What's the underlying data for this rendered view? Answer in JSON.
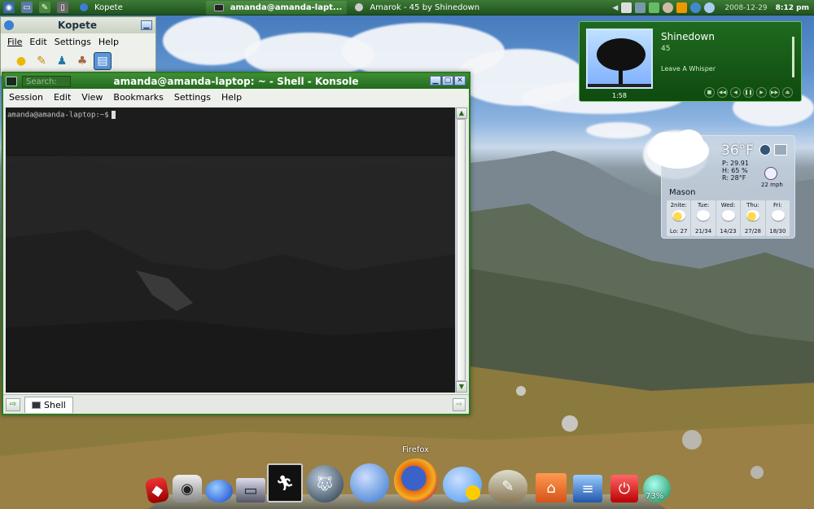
{
  "top_panel": {
    "tasks": [
      {
        "label": "Kopete",
        "active": false
      },
      {
        "label": "amanda@amanda-lapt...",
        "active": true
      },
      {
        "label": "Amarok - 45 by Shinedown",
        "active": false
      }
    ],
    "date": "2008-12-29",
    "time": "8:12 pm"
  },
  "kopete": {
    "title": "Kopete",
    "menu": [
      "File",
      "Edit",
      "Settings",
      "Help"
    ]
  },
  "konsole": {
    "title": "amanda@amanda-laptop: ~ - Shell - Konsole",
    "search_placeholder": "Search:",
    "menu": [
      "Session",
      "Edit",
      "View",
      "Bookmarks",
      "Settings",
      "Help"
    ],
    "prompt": "amanda@amanda-laptop:~$",
    "tab_label": "Shell"
  },
  "amarok": {
    "artist": "Shinedown",
    "album": "45",
    "track": "Leave A Whisper",
    "time": "1:58"
  },
  "weather": {
    "temperature": "36°F",
    "pressure": "P:  29.91",
    "humidity": "H:  65 %",
    "realfeel": "R:  28°F",
    "wind": "22 mph",
    "city": "Mason",
    "forecast": [
      {
        "day": "2nite:",
        "hilo": "Lo: 27",
        "icon": "sun"
      },
      {
        "day": "Tue:",
        "hilo": "21/34",
        "icon": "cloud"
      },
      {
        "day": "Wed:",
        "hilo": "14/23",
        "icon": "cloud"
      },
      {
        "day": "Thu:",
        "hilo": "27/28",
        "icon": "sun"
      },
      {
        "day": "Fri:",
        "hilo": "18/30",
        "icon": "cloud"
      }
    ]
  },
  "dock": {
    "hover_label": "Firefox",
    "battery_percent": "73%"
  }
}
